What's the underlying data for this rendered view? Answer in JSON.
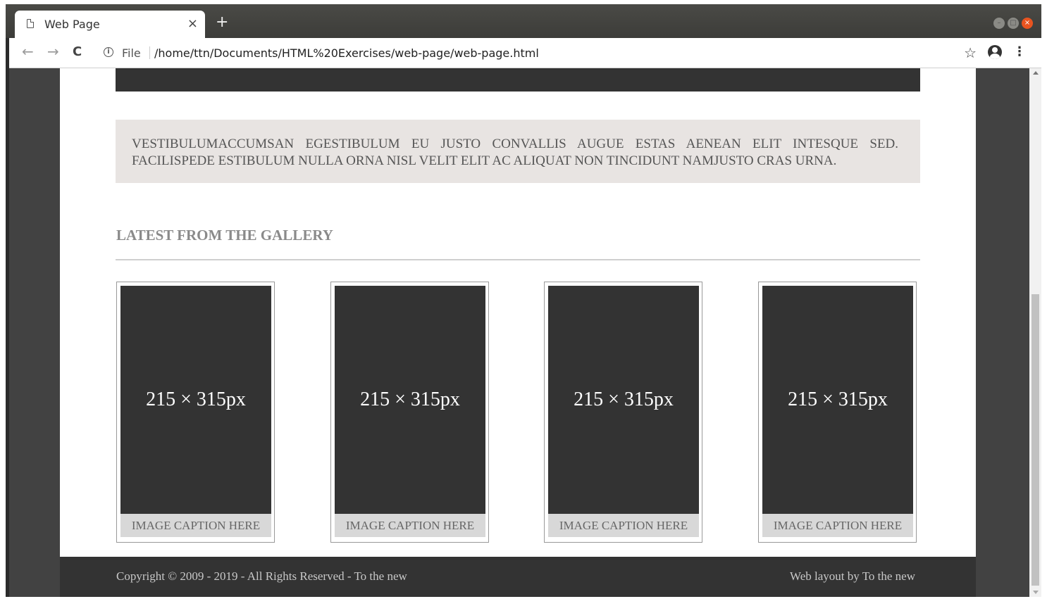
{
  "browser": {
    "tab": {
      "title": "Web Page",
      "close_label": "×"
    },
    "new_tab_label": "+",
    "address": {
      "scheme_label": "File",
      "url": "/home/ttn/Documents/HTML%20Exercises/web-page/web-page.html"
    }
  },
  "page": {
    "intro_text": "VESTIBULUMACCUMSAN EGESTIBULUM EU JUSTO CONVALLIS AUGUE ESTAS AENEAN ELIT INTESQUE SED. FACILISPEDE ESTIBULUM NULLA ORNA NISL VELIT ELIT AC ALIQUAT NON TINCIDUNT NAMJUSTO CRAS URNA.",
    "gallery": {
      "heading": "LATEST FROM THE GALLERY",
      "items": [
        {
          "image_label": "215 × 315px",
          "caption": "IMAGE CAPTION HERE"
        },
        {
          "image_label": "215 × 315px",
          "caption": "IMAGE CAPTION HERE"
        },
        {
          "image_label": "215 × 315px",
          "caption": "IMAGE CAPTION HERE"
        },
        {
          "image_label": "215 × 315px",
          "caption": "IMAGE CAPTION HERE"
        }
      ]
    },
    "footer": {
      "copyright": "Copyright © 2009 - 2019 - All Rights Reserved - To the new",
      "credit": "Web layout by To the new"
    }
  },
  "colors": {
    "dark_block": "#333333",
    "intro_background": "#e8e4e2",
    "caption_background": "#d8d8d8",
    "page_background": "#424242"
  },
  "icons": [
    "page-icon",
    "close-icon",
    "plus-icon",
    "back-arrow-icon",
    "forward-arrow-icon",
    "reload-icon",
    "info-icon",
    "star-icon",
    "account-icon",
    "menu-icon",
    "minimize-icon",
    "maximize-icon",
    "window-close-icon"
  ]
}
